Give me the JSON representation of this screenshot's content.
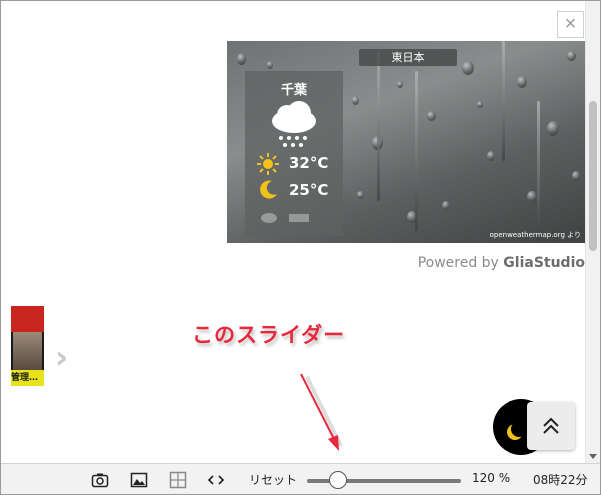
{
  "weather_card": {
    "region": "東日本",
    "city": "千葉",
    "high_temp": "32°C",
    "low_temp": "25°C",
    "credit": "openweathermap.org より"
  },
  "powered_by": {
    "prefix": "Powered by ",
    "brand": "GliaStudio"
  },
  "close_label": "×",
  "thumbnail": {
    "caption": "管理…"
  },
  "next_arrow": "›",
  "annotation": "このスライダー",
  "toolbar": {
    "reset_label": "リセット",
    "zoom_value": 0.2,
    "zoom_label": "120 %",
    "clock": "08時22分"
  },
  "colors": {
    "annotation_red": "#e8283c",
    "weather_bg": "#6e7272"
  },
  "icons": [
    "camera-icon",
    "image-icon",
    "grid-icon",
    "code-icon",
    "moon-icon",
    "chevron-double-up-icon",
    "sun-icon",
    "cloud-rain-icon",
    "close-icon"
  ]
}
